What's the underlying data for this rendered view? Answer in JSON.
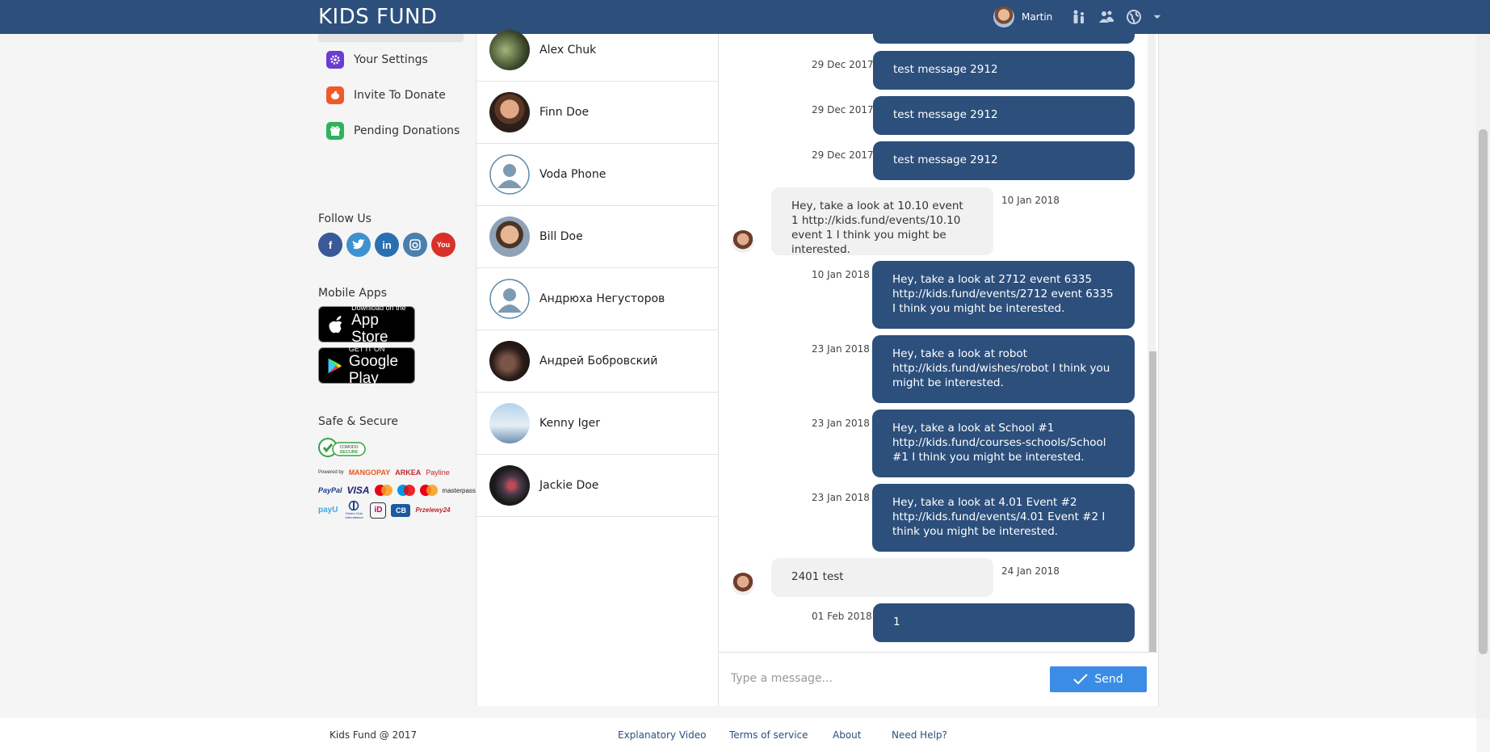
{
  "header": {
    "brand": "KIDS FUND",
    "user_name": "Martin",
    "icons": [
      "kids-icon",
      "friends-icon",
      "globe-icon",
      "dropdown-icon"
    ]
  },
  "sidebar": {
    "menu": [
      {
        "label": "Your Settings",
        "icon": "gear-icon",
        "color": "#6a3dd1"
      },
      {
        "label": "Invite To Donate",
        "icon": "piggy-bank-icon",
        "color": "#f05a28"
      },
      {
        "label": "Pending Donations",
        "icon": "gift-icon",
        "color": "#2eb35c"
      }
    ],
    "follow_title": "Follow Us",
    "socials": [
      {
        "name": "facebook",
        "glyph": "f",
        "color": "#3b5998"
      },
      {
        "name": "twitter",
        "glyph": "t",
        "color": "#3d91d1"
      },
      {
        "name": "linkedin",
        "glyph": "in",
        "color": "#2a6fb1"
      },
      {
        "name": "instagram",
        "glyph": "◎",
        "color": "#4a7fae"
      },
      {
        "name": "youtube",
        "glyph": "You",
        "color": "#d9302a"
      }
    ],
    "apps_title": "Mobile Apps",
    "app_store": {
      "small": "Download on the",
      "big": "App Store"
    },
    "google_play": {
      "small": "GET IT ON",
      "big": "Google Play"
    },
    "secure_title": "Safe & Secure",
    "comodo": {
      "top": "COMODO",
      "bottom": "SECURE"
    },
    "payments_row1": [
      "Powered by",
      "MANGOPAY",
      "ARKEA",
      "Payline"
    ],
    "payments_row2": [
      "PayPal",
      "VISA",
      "Maestro",
      "masterpass"
    ],
    "payments_row3": [
      "payU",
      "Diners Club International",
      "iD",
      "CB",
      "Przelewy24"
    ]
  },
  "contacts": [
    {
      "name": "Alex Chuk",
      "avatar": "photo-green"
    },
    {
      "name": "Finn Doe",
      "avatar": "photo-man"
    },
    {
      "name": "Voda Phone",
      "avatar": "default"
    },
    {
      "name": "Bill Doe",
      "avatar": "photo-smile"
    },
    {
      "name": "Андрюха Негусторов",
      "avatar": "default"
    },
    {
      "name": "Андрей Бобровский",
      "avatar": "photo-dark"
    },
    {
      "name": "Kenny Iger",
      "avatar": "photo-sky"
    },
    {
      "name": "Jackie Doe",
      "avatar": "photo-lights"
    }
  ],
  "messages": [
    {
      "dir": "out",
      "date": "29 Dec 2017",
      "text": "test message 2912"
    },
    {
      "dir": "out",
      "date": "29 Dec 2017",
      "text": "test message 2912"
    },
    {
      "dir": "out",
      "date": "29 Dec 2017",
      "text": "test message 2912"
    },
    {
      "dir": "in",
      "date": "10 Jan 2018",
      "text": "Hey, take a look at 10.10 event 1 http://kids.fund/events/10.10 event 1 I think you might be interested."
    },
    {
      "dir": "out",
      "date": "10 Jan 2018",
      "text": "Hey, take a look at 2712 event 6335 http://kids.fund/events/2712 event 6335 I think you might be interested."
    },
    {
      "dir": "out",
      "date": "23 Jan 2018",
      "text": "Hey, take a look at robot http://kids.fund/wishes/robot I think you might be interested."
    },
    {
      "dir": "out",
      "date": "23 Jan 2018",
      "text": "Hey, take a look at School #1 http://kids.fund/courses-schools/School #1 I think you might be interested."
    },
    {
      "dir": "out",
      "date": "23 Jan 2018",
      "text": "Hey, take a look at 4.01 Event #2 http://kids.fund/events/4.01 Event #2 I think you might be interested."
    },
    {
      "dir": "in",
      "date": "24 Jan 2018",
      "text": "2401 test"
    },
    {
      "dir": "out",
      "date": "01 Feb 2018",
      "text": "1"
    }
  ],
  "composer": {
    "placeholder": "Type a message...",
    "value": "",
    "send_label": "Send"
  },
  "footer": {
    "copyright": "Kids Fund @ 2017",
    "links": [
      "Explanatory Video",
      "Terms of service",
      "About",
      "Need Help?"
    ]
  },
  "colors": {
    "brand": "#2c4f7c",
    "send_button": "#3b8ce5",
    "incoming_bubble": "#f1f1f1"
  }
}
